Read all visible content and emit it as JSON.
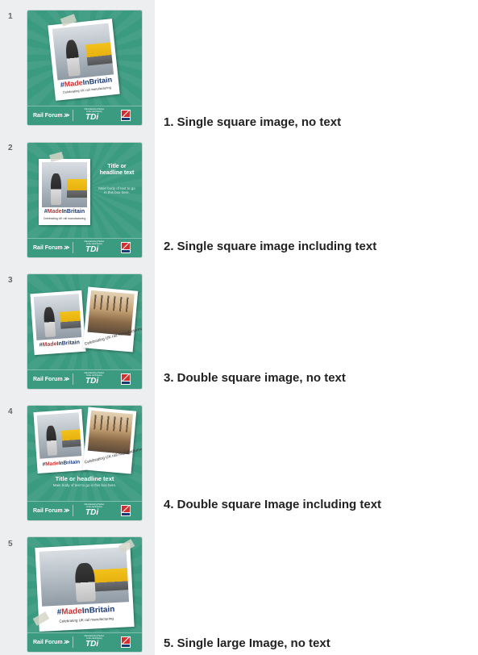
{
  "slides": [
    {
      "number": "1",
      "label": "1. Single square image, no text",
      "caption_hash": "#",
      "caption_made": "Made",
      "caption_in_britain": "InBritain",
      "caption_sub": "Celebrating UK rail manufacturing"
    },
    {
      "number": "2",
      "label": "2. Single square image including text",
      "caption_hash": "#",
      "caption_made": "Made",
      "caption_in_britain": "InBritain",
      "caption_sub": "Celebrating UK rail manufacturing",
      "headline": "Title or headline text",
      "body": "Main body of text to go in this box here."
    },
    {
      "number": "3",
      "label": "3. Double square image, no text",
      "caption_hash": "#",
      "caption_made": "Made",
      "caption_in_britain": "InBritain",
      "caption_sub": "Celebrating UK rail manufacturing"
    },
    {
      "number": "4",
      "label": "4. Double square Image including text",
      "caption_hash": "#",
      "caption_made": "Made",
      "caption_in_britain": "InBritain",
      "caption_sub": "Celebrating UK rail manufacturing",
      "headline": "Title or headline text",
      "body": "Main body of text to go in this box here."
    },
    {
      "number": "5",
      "label": "5. Single large Image, no text",
      "caption_hash": "#",
      "caption_made": "Made",
      "caption_in_britain": "InBritain",
      "caption_sub": "Celebrating UK rail manufacturing"
    }
  ],
  "footer": {
    "rail_forum": "Rail Forum",
    "tdi_tagline": "Manufacturing Partner to the rail industry",
    "tdi": "TDi"
  },
  "colors": {
    "slide_bg": "#3b9b81",
    "brand_blue": "#1a3a7a",
    "brand_red": "#d32f2f"
  }
}
